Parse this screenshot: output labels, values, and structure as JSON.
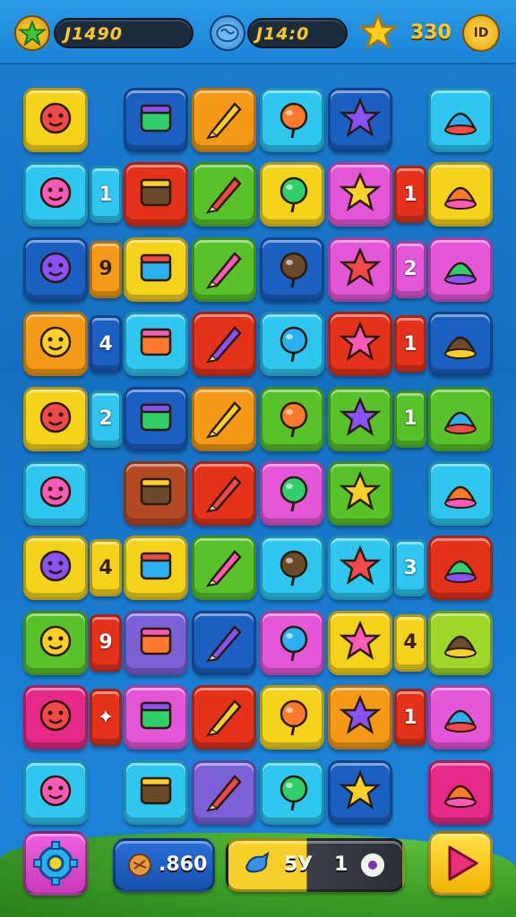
{
  "hud": {
    "left_counter": "J1490",
    "middle_counter": "J14:0",
    "right_counter": "330",
    "menu_glyph": "ID"
  },
  "bottom_bar": {
    "coins_value": ".860",
    "center_left_value": "5У",
    "center_right_value": "1"
  },
  "colors": {
    "yellow": "#f5d31c",
    "dark_blue": "#1b5fc0",
    "cyan": "#2fc6ef",
    "red": "#e5321b",
    "green": "#58c22a",
    "pink": "#e456d8",
    "orange": "#f59a16",
    "brown": "#b44a23",
    "lime": "#9fd82a",
    "purple": "#7b61d8",
    "magenta": "#e42a86"
  },
  "grid": {
    "tiles": [
      {
        "c": "yellow",
        "icon": "sun-face"
      },
      {
        "c": "dark_blue",
        "icon": "magnifier"
      },
      {
        "c": "orange",
        "icon": "green-cross"
      },
      {
        "c": "cyan",
        "icon": "red-crayon"
      },
      {
        "c": "dark_blue",
        "icon": "brush"
      },
      {
        "c": "cyan",
        "icon": "green-pencil"
      },
      {
        "c": "cyan",
        "icon": "red-box"
      },
      {
        "c": "red",
        "icon": "pink-spray"
      },
      {
        "c": "green",
        "icon": "pink-bulb"
      },
      {
        "c": "yellow",
        "icon": "orange-flower"
      },
      {
        "c": "pink",
        "icon": "blue-mirror"
      },
      {
        "c": "yellow",
        "icon": "green-ring"
      },
      {
        "c": "dark_blue",
        "icon": "green-backpack"
      },
      {
        "c": "yellow",
        "icon": "pencil-eraser"
      },
      {
        "c": "green",
        "icon": "orange-bottle"
      },
      {
        "c": "dark_blue",
        "icon": "pink-bag"
      },
      {
        "c": "pink",
        "icon": "camera"
      },
      {
        "c": "pink",
        "icon": "paper-plane"
      },
      {
        "c": "orange",
        "icon": "dark-ball"
      },
      {
        "c": "cyan",
        "icon": "blue-eraser"
      },
      {
        "c": "red",
        "icon": "kite"
      },
      {
        "c": "cyan",
        "icon": "green-balloon"
      },
      {
        "c": "red",
        "icon": "books"
      },
      {
        "c": "dark_blue",
        "icon": "orange-crab"
      },
      {
        "c": "yellow",
        "icon": "pink-flower"
      },
      {
        "c": "dark_blue",
        "icon": "toy-car"
      },
      {
        "c": "orange",
        "icon": "leaf-brush"
      },
      {
        "c": "green",
        "icon": "red-lollipop"
      },
      {
        "c": "green",
        "icon": "drum"
      },
      {
        "c": "green",
        "icon": "purple-ball"
      },
      {
        "c": "cyan",
        "icon": "purple-bell"
      },
      {
        "c": "brown",
        "icon": "octopus"
      },
      {
        "c": "red",
        "icon": "orange-leaf"
      },
      {
        "c": "pink",
        "icon": "red-face"
      },
      {
        "c": "green",
        "icon": "syringe"
      },
      {
        "c": "cyan",
        "icon": "yellow-desk"
      },
      {
        "c": "yellow",
        "icon": "monkey"
      },
      {
        "c": "yellow",
        "icon": "blue-ring"
      },
      {
        "c": "green",
        "icon": "purple-box"
      },
      {
        "c": "cyan",
        "icon": "yellow-key"
      },
      {
        "c": "cyan",
        "icon": "purple-card"
      },
      {
        "c": "red",
        "icon": "orange-chest"
      },
      {
        "c": "green",
        "icon": "red-marker"
      },
      {
        "c": "purple",
        "icon": "yellow-bird"
      },
      {
        "c": "dark_blue",
        "icon": "gray-spring"
      },
      {
        "c": "pink",
        "icon": "yellow-sun"
      },
      {
        "c": "yellow",
        "icon": "gear"
      },
      {
        "c": "lime",
        "icon": "radio"
      },
      {
        "c": "magenta",
        "icon": "ice-cream"
      },
      {
        "c": "pink",
        "icon": "yellow-tube"
      },
      {
        "c": "red",
        "icon": "crossed-tools"
      },
      {
        "c": "yellow",
        "icon": "green-arrow"
      },
      {
        "c": "orange",
        "icon": "purple-pen"
      },
      {
        "c": "pink",
        "icon": "orange-block"
      },
      {
        "c": "cyan",
        "icon": "gift-box"
      },
      {
        "c": "cyan",
        "icon": "green-drop"
      },
      {
        "c": "purple",
        "icon": "control-panel"
      },
      {
        "c": "cyan",
        "icon": "red-rocket"
      },
      {
        "c": "dark_blue",
        "icon": "bone"
      },
      {
        "c": "magenta",
        "icon": "blue-pen"
      }
    ],
    "side_tiles": [
      {
        "row": 1,
        "gap": 0,
        "c": "cyan",
        "label": "1"
      },
      {
        "row": 1,
        "gap": 4,
        "c": "red",
        "label": "1"
      },
      {
        "row": 2,
        "gap": 0,
        "c": "orange",
        "label": "9"
      },
      {
        "row": 2,
        "gap": 4,
        "c": "pink",
        "label": "2"
      },
      {
        "row": 3,
        "gap": 0,
        "c": "dark_blue",
        "label": "4"
      },
      {
        "row": 3,
        "gap": 4,
        "c": "red",
        "label": "1"
      },
      {
        "row": 4,
        "gap": 0,
        "c": "cyan",
        "label": "2"
      },
      {
        "row": 4,
        "gap": 4,
        "c": "green",
        "label": "1"
      },
      {
        "row": 6,
        "gap": 0,
        "c": "yellow",
        "label": "4"
      },
      {
        "row": 6,
        "gap": 4,
        "c": "cyan",
        "label": "3"
      },
      {
        "row": 7,
        "gap": 0,
        "c": "red",
        "label": "9"
      },
      {
        "row": 7,
        "gap": 4,
        "c": "yellow",
        "label": "4"
      },
      {
        "row": 8,
        "gap": 0,
        "c": "red",
        "label": "✦"
      },
      {
        "row": 8,
        "gap": 4,
        "c": "red",
        "label": "1"
      }
    ]
  }
}
